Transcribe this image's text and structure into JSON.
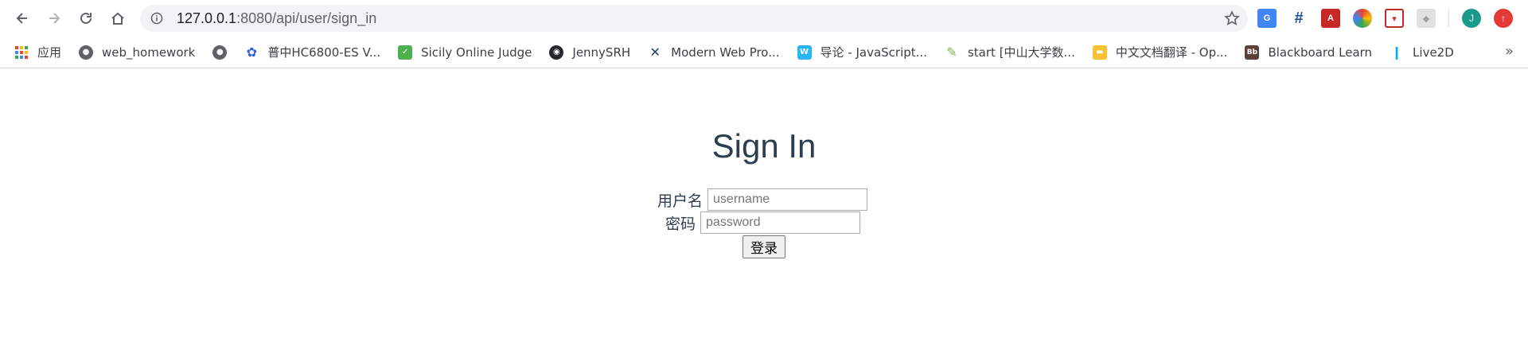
{
  "browser": {
    "url_host": "127.0.0.1",
    "url_rest": ":8080/api/user/sign_in",
    "profile_initial": "J"
  },
  "bookmarks": [
    {
      "label": "应用",
      "icon": "apps-grid-icon"
    },
    {
      "label": "web_homework",
      "icon": "globe-icon"
    },
    {
      "label": "",
      "icon": "globe-icon"
    },
    {
      "label": "普中HC6800-ES V...",
      "icon": "baidu-paw-icon"
    },
    {
      "label": "Sicily Online Judge",
      "icon": "green-check-icon"
    },
    {
      "label": "JennySRH",
      "icon": "github-icon"
    },
    {
      "label": "Modern Web Pro...",
      "icon": "swords-icon"
    },
    {
      "label": "导论 - JavaScript...",
      "icon": "w-icon"
    },
    {
      "label": "start [中山大学数...",
      "icon": "pencil-icon"
    },
    {
      "label": "中文文档翻译 - Op...",
      "icon": "folder-icon"
    },
    {
      "label": "Blackboard Learn",
      "icon": "bb-icon"
    },
    {
      "label": "Live2D",
      "icon": "live2d-icon"
    }
  ],
  "page": {
    "title": "Sign In",
    "username_label": "用户名",
    "username_placeholder": "username",
    "password_label": "密码",
    "password_placeholder": "password",
    "submit_label": "登录"
  },
  "colors": {
    "heading": "#2c3e50",
    "profile": "#1a9a8a",
    "accent_red": "#e53935"
  }
}
